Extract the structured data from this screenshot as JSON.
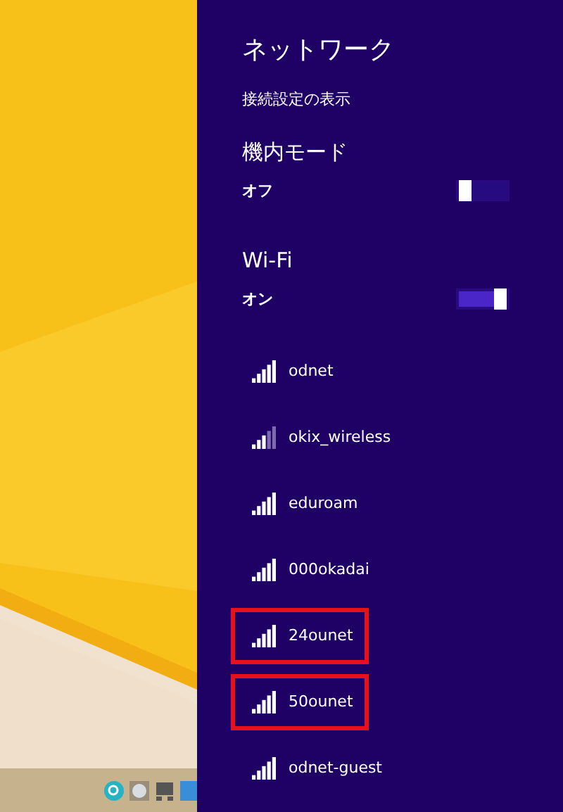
{
  "panel": {
    "title": "ネットワーク",
    "link": "接続設定の表示"
  },
  "airplane_mode": {
    "heading": "機内モード",
    "state_label": "オフ",
    "on": false
  },
  "wifi": {
    "heading": "Wi-Fi",
    "state_label": "オン",
    "on": true
  },
  "networks": [
    {
      "name": "odnet",
      "kind": "strong",
      "highlighted": false
    },
    {
      "name": "okix_wireless",
      "kind": "weak",
      "highlighted": false
    },
    {
      "name": "eduroam",
      "kind": "strong",
      "highlighted": false
    },
    {
      "name": "000okadai",
      "kind": "strong",
      "highlighted": false
    },
    {
      "name": "24ounet",
      "kind": "strong",
      "highlighted": true
    },
    {
      "name": "50ounet",
      "kind": "strong",
      "highlighted": true
    },
    {
      "name": "odnet-guest",
      "kind": "strong",
      "highlighted": false
    }
  ]
}
